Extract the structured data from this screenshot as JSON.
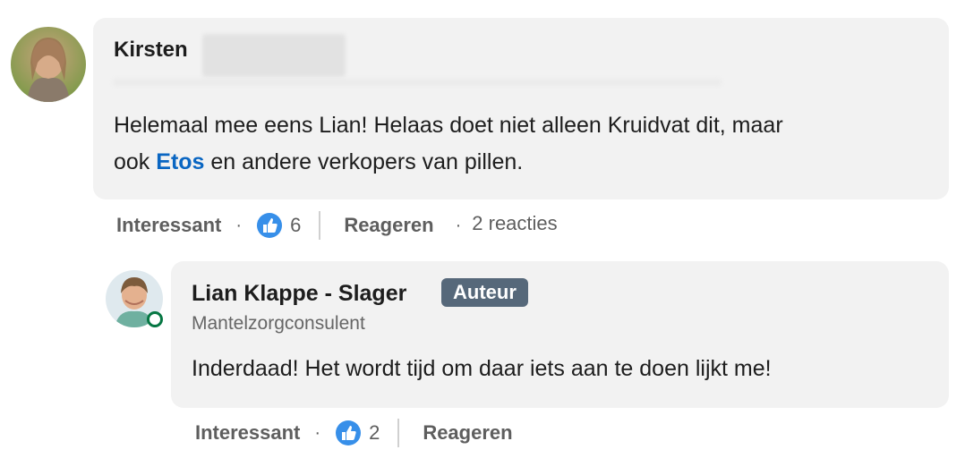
{
  "comment": {
    "author_first_name": "Kirsten",
    "body_before_link": "Helemaal mee eens Lian! Helaas doet niet alleen Kruidvat dit, maar",
    "body_line2_prefix": "ook ",
    "link_text": "Etos",
    "body_after_link": " en andere verkopers van pillen.",
    "actions": {
      "like_label": "Interessant",
      "dot": "·",
      "reaction_count": "6",
      "reply_label": "Reageren",
      "replies_text": "2 reacties"
    }
  },
  "reply": {
    "author_name": "Lian Klappe - Slager",
    "badge": "Auteur",
    "headline": "Mantelzorgconsulent",
    "body": "Inderdaad! Het wordt tijd om daar iets aan te doen lijkt me!",
    "actions": {
      "like_label": "Interessant",
      "dot": "·",
      "reaction_count": "2",
      "reply_label": "Reageren"
    }
  },
  "colors": {
    "link": "#0a66c2",
    "badge_bg": "#56687a",
    "bubble_bg": "#f2f2f2",
    "online": "#057642",
    "like_icon": "#378fe9"
  },
  "icons": {
    "reaction": "thumbs-up-icon",
    "presence": "online-status-icon"
  }
}
